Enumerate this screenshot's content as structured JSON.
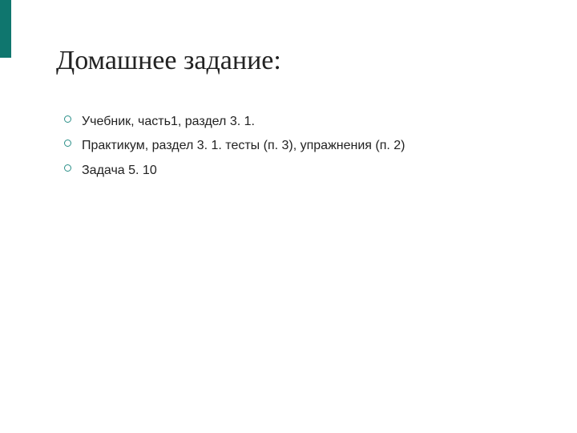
{
  "accent_color": "#0f766e",
  "slide": {
    "title": "Домашнее задание:",
    "bullets": [
      "Учебник, часть1, раздел 3. 1.",
      "Практикум, раздел 3. 1. тесты (п. 3), упражнения (п. 2)",
      "Задача 5. 10"
    ]
  }
}
